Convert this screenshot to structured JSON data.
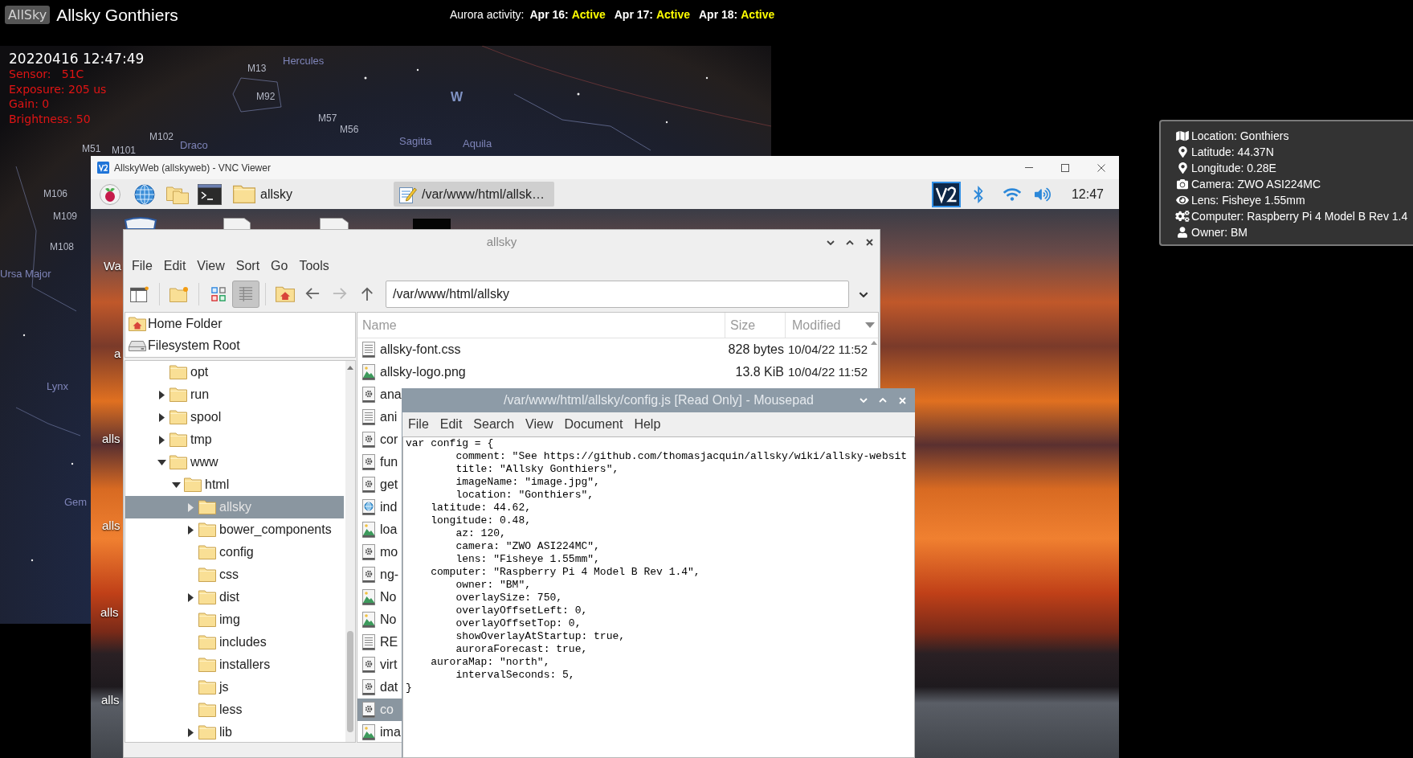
{
  "header": {
    "badge": "AllSky",
    "title": "Allsky Gonthiers",
    "aurora": {
      "label": "Aurora activity:",
      "days": [
        {
          "date": "Apr 16:",
          "status": "Active"
        },
        {
          "date": "Apr 17:",
          "status": "Active"
        },
        {
          "date": "Apr 18:",
          "status": "Active"
        }
      ]
    }
  },
  "sky_image": {
    "timestamp": "20220416 12:47:49",
    "readings": [
      "Sensor:   51C",
      "Exposure: 205 us",
      "Gain: 0",
      "Brightness: 50"
    ],
    "labels": [
      {
        "text": "Hercules",
        "kind": "constellation"
      },
      {
        "text": "M13",
        "kind": "object"
      },
      {
        "text": "M92",
        "kind": "object"
      },
      {
        "text": "W",
        "kind": "direction"
      },
      {
        "text": "M57",
        "kind": "object"
      },
      {
        "text": "M56",
        "kind": "object"
      },
      {
        "text": "Sagitta",
        "kind": "constellation"
      },
      {
        "text": "Aquila",
        "kind": "constellation"
      },
      {
        "text": "M102",
        "kind": "object"
      },
      {
        "text": "Draco",
        "kind": "constellation"
      },
      {
        "text": "M51",
        "kind": "object"
      },
      {
        "text": "M101",
        "kind": "object"
      },
      {
        "text": "M106",
        "kind": "object"
      },
      {
        "text": "M109",
        "kind": "object"
      },
      {
        "text": "M108",
        "kind": "object"
      },
      {
        "text": "Ursa Major",
        "kind": "constellation"
      },
      {
        "text": "Lynx",
        "kind": "constellation"
      },
      {
        "text": "Gem",
        "kind": "constellation"
      }
    ]
  },
  "info_panel": {
    "items": [
      {
        "kind": "location",
        "text": "Location: Gonthiers"
      },
      {
        "kind": "latitude",
        "text": "Latitude: 44.37N"
      },
      {
        "kind": "longitude",
        "text": "Longitude: 0.28E"
      },
      {
        "kind": "camera",
        "text": "Camera: ZWO ASI224MC"
      },
      {
        "kind": "lens",
        "text": "Lens: Fisheye 1.55mm"
      },
      {
        "kind": "computer",
        "text": "Computer: Raspberry Pi 4 Model B Rev 1.4"
      },
      {
        "kind": "owner",
        "text": "Owner: BM"
      }
    ]
  },
  "vnc": {
    "title": "AllskyWeb (allskyweb) - VNC Viewer",
    "taskbar": {
      "tasks": [
        {
          "label": "allsky",
          "kind": "folder",
          "selected": false
        },
        {
          "label": "/var/www/html/allsk…",
          "kind": "editor",
          "selected": true
        }
      ],
      "clock": "12:47"
    },
    "desktop_labels": [
      "Wa",
      "a",
      "alls",
      "alls",
      "alls",
      "alls"
    ]
  },
  "file_manager": {
    "title": "allsky",
    "menu": [
      "File",
      "Edit",
      "View",
      "Sort",
      "Go",
      "Tools"
    ],
    "toolbar": {
      "view_buttons": [
        {
          "kind": "icons",
          "selected": false
        },
        {
          "kind": "list",
          "selected": true
        }
      ],
      "nav_buttons": [
        {
          "kind": "back",
          "disabled": false
        },
        {
          "kind": "forward",
          "disabled": true
        },
        {
          "kind": "up",
          "disabled": false
        }
      ]
    },
    "path": "/var/www/html/allsky",
    "places": [
      {
        "name": "Home Folder",
        "kind": "home",
        "selected": false
      },
      {
        "name": "Filesystem Root",
        "kind": "drive",
        "selected": false
      }
    ],
    "tree": [
      {
        "name": "opt",
        "selected": false
      },
      {
        "name": "run",
        "expanded": false,
        "selected": false
      },
      {
        "name": "spool",
        "expanded": false,
        "selected": false
      },
      {
        "name": "tmp",
        "expanded": false,
        "selected": false
      },
      {
        "name": "www",
        "expanded": true,
        "selected": false,
        "children": [
          {
            "name": "html",
            "expanded": true,
            "selected": false,
            "children": [
              {
                "name": "allsky",
                "expanded": false,
                "selected": true
              },
              {
                "name": "bower_components",
                "expanded": false,
                "selected": false
              },
              {
                "name": "config",
                "selected": false
              },
              {
                "name": "css",
                "selected": false
              },
              {
                "name": "dist",
                "expanded": false,
                "selected": false
              },
              {
                "name": "img",
                "selected": false
              },
              {
                "name": "includes",
                "selected": false
              },
              {
                "name": "installers",
                "selected": false
              },
              {
                "name": "js",
                "selected": false
              },
              {
                "name": "less",
                "selected": false
              },
              {
                "name": "lib",
                "expanded": false,
                "selected": false
              }
            ]
          }
        ]
      }
    ],
    "columns": [
      "Name",
      "Size",
      "Modified"
    ],
    "files": [
      {
        "name": "allsky-font.css",
        "kind": "text",
        "size": "828 bytes",
        "modified": "10/04/22 11:52",
        "selected": false
      },
      {
        "name": "allsky-logo.png",
        "kind": "image",
        "size": "13.8 KiB",
        "modified": "10/04/22 11:52",
        "selected": false
      },
      {
        "name": "ana",
        "kind": "script",
        "selected": false
      },
      {
        "name": "ani",
        "kind": "text",
        "selected": false
      },
      {
        "name": "cor",
        "kind": "script",
        "selected": false
      },
      {
        "name": "fun",
        "kind": "script",
        "selected": false
      },
      {
        "name": "get",
        "kind": "script",
        "selected": false
      },
      {
        "name": "ind",
        "kind": "web",
        "selected": false
      },
      {
        "name": "loa",
        "kind": "image",
        "selected": false
      },
      {
        "name": "mo",
        "kind": "script",
        "selected": false
      },
      {
        "name": "ng-",
        "kind": "script",
        "selected": false
      },
      {
        "name": "No",
        "kind": "image",
        "selected": false
      },
      {
        "name": "No",
        "kind": "image",
        "selected": false
      },
      {
        "name": "RE",
        "kind": "text",
        "selected": false
      },
      {
        "name": "virt",
        "kind": "script",
        "selected": false
      },
      {
        "name": "dat",
        "kind": "script",
        "selected": false
      },
      {
        "name": "co",
        "kind": "script",
        "selected": true
      },
      {
        "name": "ima",
        "kind": "image",
        "selected": false
      }
    ]
  },
  "mousepad": {
    "title": "/var/www/html/allsky/config.js [Read Only] - Mousepad",
    "menu": [
      "File",
      "Edit",
      "Search",
      "View",
      "Document",
      "Help"
    ],
    "lines": [
      "var config = {",
      "        comment: \"See https://github.com/thomasjacquin/allsky/wiki/allsky-websit",
      "        title: \"Allsky Gonthiers\",",
      "        imageName: \"image.jpg\",",
      "        location: \"Gonthiers\",",
      "    latitude: 44.62,",
      "    longitude: 0.48,",
      "        az: 120,",
      "        camera: \"ZWO ASI224MC\",",
      "        lens: \"Fisheye 1.55mm\",",
      "    computer: \"Raspberry Pi 4 Model B Rev 1.4\",",
      "        owner: \"BM\",",
      "        overlaySize: 750,",
      "        overlayOffsetLeft: 0,",
      "        overlayOffsetTop: 0,",
      "        showOverlayAtStartup: true,",
      "        auroraForecast: true,",
      "    auroraMap: \"north\",",
      "        intervalSeconds: 5,",
      "}"
    ]
  }
}
